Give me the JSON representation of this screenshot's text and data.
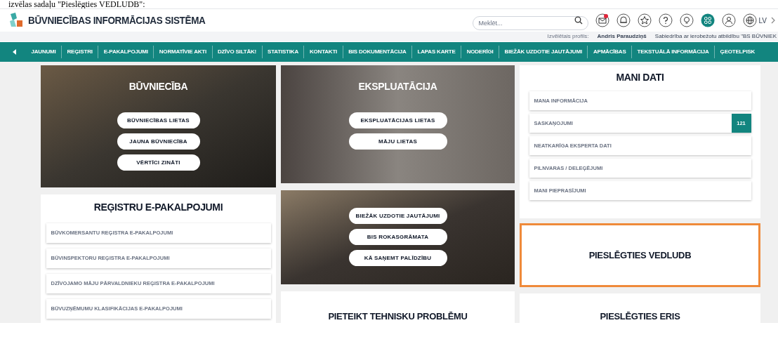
{
  "caption": "izvēlas sadaļu \"Pieslēgties VEDLUDB\":",
  "header": {
    "logo_text": "BŪVNIECĪBAS INFORMĀCIJAS SISTĒMA",
    "search": {
      "placeholder": "Meklēt..."
    },
    "icons": [
      {
        "kind": "mail",
        "selected": false,
        "notification": true
      },
      {
        "kind": "bell",
        "selected": false,
        "notification": false
      },
      {
        "kind": "star",
        "selected": false,
        "notification": false
      },
      {
        "kind": "help",
        "selected": false,
        "notification": false
      },
      {
        "kind": "bulb",
        "selected": false,
        "notification": false
      },
      {
        "kind": "apps",
        "selected": true,
        "notification": false
      },
      {
        "kind": "user",
        "selected": false,
        "notification": false
      },
      {
        "kind": "globe",
        "selected": false,
        "notification": false
      }
    ],
    "language": "LV"
  },
  "profile": {
    "label": "Izvēlētais profils:",
    "name": "Andris Paraudziņš",
    "organization": "Sabiedrība ar ierobežotu atbildību \"BS BŪVNIEK"
  },
  "nav": {
    "items": [
      "JAUNUMI",
      "REĢISTRI",
      "E-PAKALPOJUMI",
      "NORMATĪVIE AKTI",
      "DZĪVO SILTĀK!",
      "STATISTIKA",
      "KONTAKTI",
      "BIS DOKUMENTĀCIJA",
      "LAPAS KARTE",
      "NODERĪGI",
      "BIEŽĀK UZDOTIE JAUTĀJUMI",
      "APMĀCĪBAS",
      "TEKSTUĀLĀ INFORMĀCIJA",
      "ĢEOTELPISK"
    ]
  },
  "construction": {
    "title": "BŪVNIECĪBA",
    "buttons": [
      "BŪVNIECĪBAS LIETAS",
      "JAUNA BŪVNIECĪBA",
      "VĒRTĪCI ZINĀTI"
    ]
  },
  "operation": {
    "title": "EKSPLUATĀCIJA",
    "buttons": [
      "EKSPLUATĀCIJAS LIETAS",
      "MĀJU LIETAS"
    ]
  },
  "my_data": {
    "title": "MANI DATI",
    "items": [
      {
        "label": "MANA INFORMĀCIJA"
      },
      {
        "label": "SASKAŅOJUMI",
        "count": "121"
      },
      {
        "label": "NEATKARĪGA EKSPERTA DATI"
      },
      {
        "label": "PILNVARAS / DELEĢĒJUMI"
      },
      {
        "label": "MANI PIEPRASĪJUMI"
      }
    ]
  },
  "registers": {
    "title": "REĢISTRU E-PAKALPOJUMI",
    "items": [
      "BŪVKOMERSANTU REĢISTRA E-PAKALPOJUMI",
      "BŪVINSPEKTORU REĢISTRA E-PAKALPOJUMI",
      "DZĪVOJAMO MĀJU PĀRVALDNIEKU REĢISTRA E-PAKALPOJUMI",
      "BŪVUZŅĒMUMU KLASIFIKĀCIJAS E-PAKALPOJUMI"
    ]
  },
  "help": {
    "buttons": [
      "BIEŽĀK UZDOTIE JAUTĀJUMI",
      "BIS ROKASGRĀMATA",
      "KĀ SAŅEMT PALĪDZĪBU"
    ]
  },
  "vedludb": {
    "title": "PIESLĒGTIES VEDLUDB",
    "highlighted": true
  },
  "report": {
    "title": "PIETEIKT TEHNISKU PROBLĒMU"
  },
  "eris": {
    "title": "PIESLĒGTIES ERIS"
  }
}
